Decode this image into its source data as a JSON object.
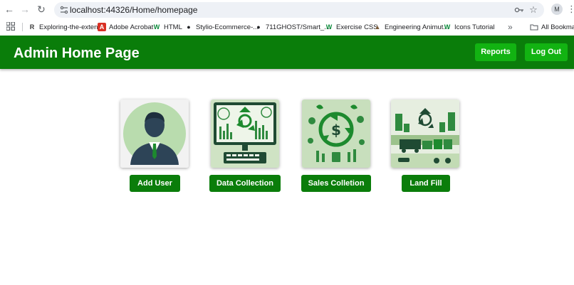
{
  "browser": {
    "url_host": "localhost",
    "url_path": ":44326/Home/homepage",
    "avatar_initial": "M",
    "bookmarks": [
      {
        "label": "Exploring-the-exten...",
        "icon": "R",
        "color": "#3b3b3b"
      },
      {
        "label": "Adobe Acrobat",
        "icon": "A",
        "color": "#d93025"
      },
      {
        "label": "HTML",
        "icon": "W",
        "color": "#0a8a3a"
      },
      {
        "label": "Stylio-Ecommerce-...",
        "icon": "●",
        "color": "#202124"
      },
      {
        "label": "711GHOST/Smart_...",
        "icon": "●",
        "color": "#202124"
      },
      {
        "label": "Exercise CSS",
        "icon": "W",
        "color": "#0a8a3a"
      },
      {
        "label": "Engineering Animut...",
        "icon": "▲",
        "color": "#7a5b3a"
      },
      {
        "label": "Icons Tutorial",
        "icon": "W",
        "color": "#0a8a3a"
      }
    ],
    "overflow_label": "»",
    "all_bookmarks_label": "All Bookmarks"
  },
  "header": {
    "title": "Admin Home Page",
    "reports_label": "Reports",
    "logout_label": "Log Out"
  },
  "cards": [
    {
      "label": "Add User"
    },
    {
      "label": "Data Collection"
    },
    {
      "label": "Sales Colletion"
    },
    {
      "label": "Land Fill"
    }
  ],
  "colors": {
    "header_bg": "#0a7d0a",
    "header_button_bg": "#12b312",
    "card_button_bg": "#0a7d0a"
  }
}
